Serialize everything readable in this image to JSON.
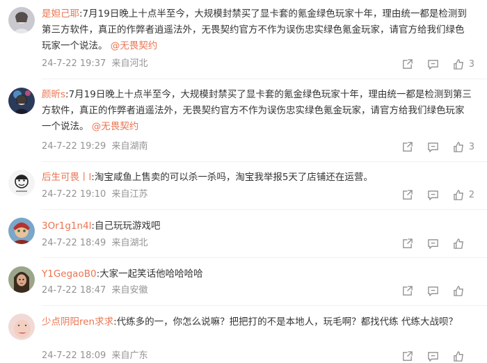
{
  "comments": [
    {
      "user": "是妲己耶",
      "body": ":7月19日晚上十点半至今，大规模封禁买了显卡套的氪金绿色玩家十年，理由统一都是检测到第三方软件，真正的作弊者逍遥法外，无畏契约官方不作为误伤忠实绿色氪金玩家，请官方给我们绿色玩家一个说法。",
      "mention": "@无畏契约",
      "time": "24-7-22 19:37",
      "location": "来自河北",
      "likes": "3"
    },
    {
      "user": "颜昕s",
      "body": ":7月19日晚上十点半至今，大规模封禁买了显卡套的氪金绿色玩家十年，理由统一都是检测到第三方软件，真正的作弊者逍遥法外，无畏契约官方不作为误伤忠实绿色氪金玩家，请官方给我们绿色玩家一个说法。",
      "mention": "@无畏契约",
      "time": "24-7-22 19:29",
      "location": "来自湖南",
      "likes": "3"
    },
    {
      "user": "后生可畏丨l",
      "body": ":淘宝咸鱼上售卖的可以杀一杀吗，淘宝我举报5天了店铺还在运营。",
      "mention": "",
      "time": "24-7-22 19:10",
      "location": "来自江苏",
      "likes": "2"
    },
    {
      "user": "3Or1g1n4l",
      "body": ":自己玩玩游戏吧",
      "mention": "",
      "time": "24-7-22 18:49",
      "location": "来自湖北",
      "likes": ""
    },
    {
      "user": "Y1GegaoB0",
      "body": ":大家一起笑话他哈哈哈哈",
      "mention": "",
      "time": "24-7-22 18:47",
      "location": "来自安徽",
      "likes": ""
    },
    {
      "user": "少点阴阳ren求求",
      "body": ":代练多的一，你怎么说嘛？把把打的不是本地人，玩毛啊？都找代练 代练大战呗？",
      "mention": "",
      "time": "24-7-22 18:09",
      "location": "来自广东",
      "likes": ""
    }
  ],
  "icons": {
    "share": "share-icon",
    "reply": "comment-icon",
    "like": "thumbs-up-icon"
  },
  "colors": {
    "nickname": "#eb7350",
    "meta": "#939393",
    "text": "#333333"
  }
}
